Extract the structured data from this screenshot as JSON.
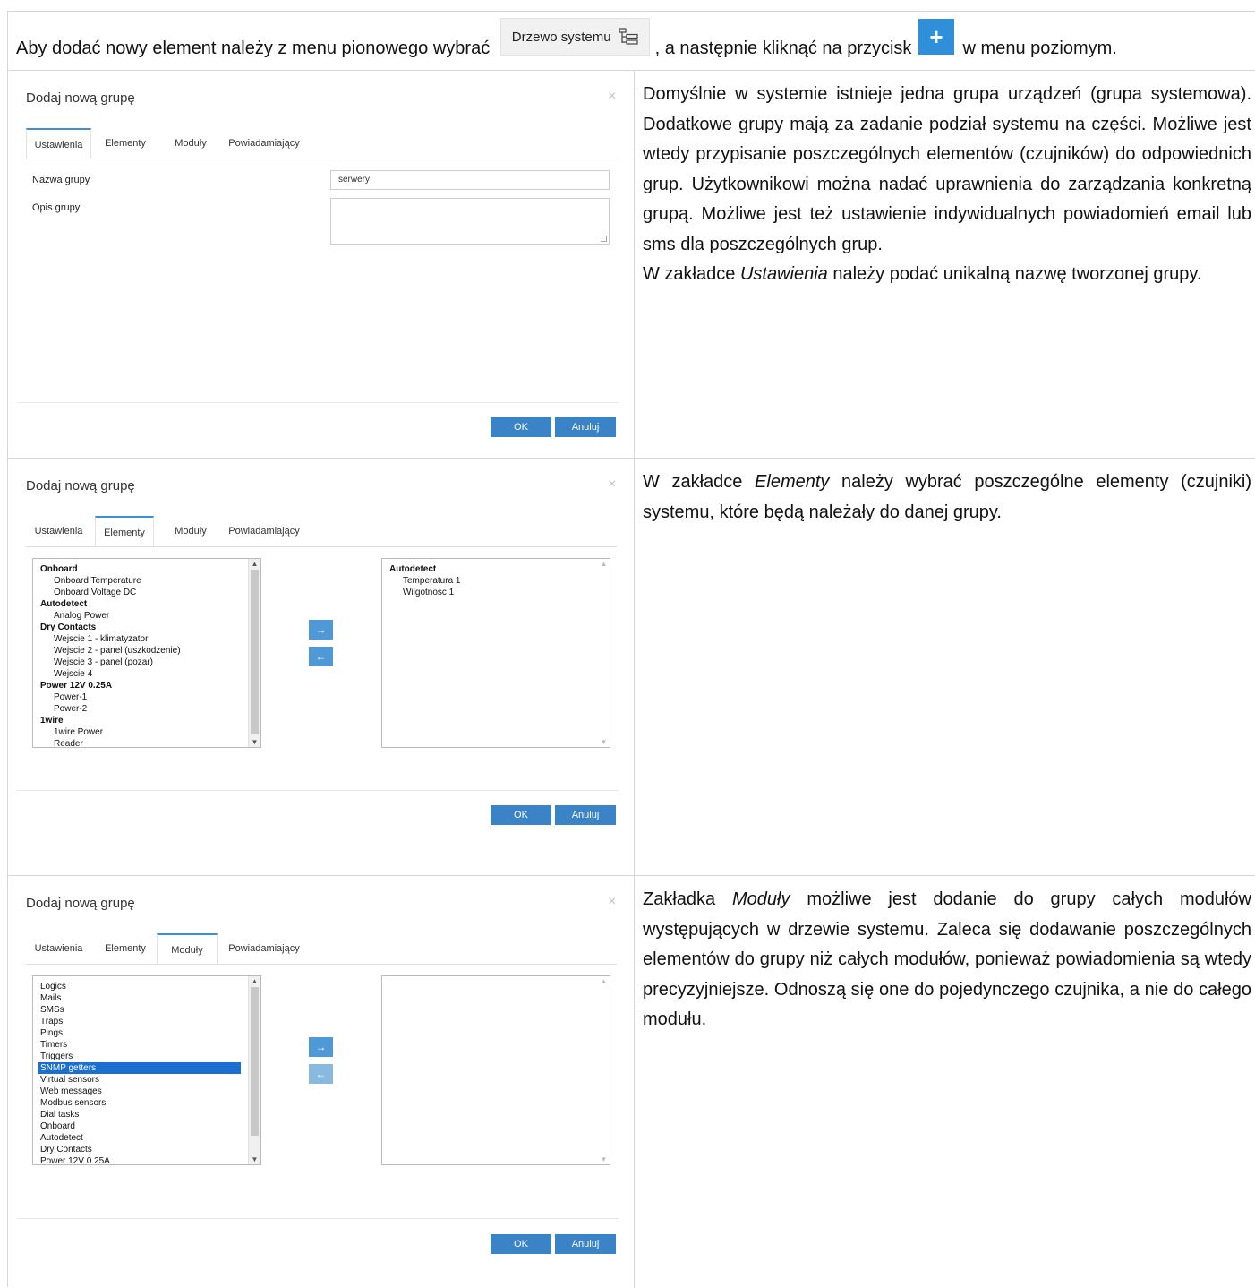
{
  "intro": {
    "text_before": "Aby dodać nowy element należy z menu pionowego wybrać ",
    "tree_button_label": "Drzewo systemu",
    "text_middle": ", a następnie kliknąć na przycisk ",
    "plus_label": "+",
    "text_after": " w menu poziomym."
  },
  "dialog_common": {
    "title": "Dodaj nową grupę",
    "close": "×",
    "tabs": [
      "Ustawienia",
      "Elementy",
      "Moduły",
      "Powiadamiający"
    ],
    "ok": "OK",
    "cancel": "Anuluj",
    "arrow_right": "→",
    "arrow_left": "←"
  },
  "row1": {
    "active_tab": "Ustawienia",
    "name_label": "Nazwa grupy",
    "name_value": "serwery",
    "desc_label": "Opis grupy",
    "description_p1": "Domyślnie w systemie istnieje jedna grupa urządzeń (grupa systemowa). Dodatkowe grupy mają za zadanie podział systemu na części. Możliwe jest wtedy przypisanie poszczególnych elementów (czujników) do odpowiednich grup. Użytkownikowi można nadać uprawnienia do zarządzania konkretną grupą. Możliwe jest też ustawienie indywidualnych powiadomień email lub sms dla poszczególnych grup.",
    "description_p2_before": "W zakładce ",
    "description_p2_em": "Ustawienia",
    "description_p2_after": " należy podać unikalną nazwę tworzonej grupy."
  },
  "row2": {
    "active_tab": "Elementy",
    "left_list": [
      {
        "text": "Onboard",
        "group": true
      },
      {
        "text": "Onboard Temperature",
        "group": false
      },
      {
        "text": "Onboard Voltage DC",
        "group": false
      },
      {
        "text": "Autodetect",
        "group": true
      },
      {
        "text": "Analog Power",
        "group": false
      },
      {
        "text": "Dry Contacts",
        "group": true
      },
      {
        "text": "Wejscie 1 - klimatyzator",
        "group": false
      },
      {
        "text": "Wejscie 2 - panel (uszkodzenie)",
        "group": false
      },
      {
        "text": "Wejscie 3 - panel (pozar)",
        "group": false
      },
      {
        "text": "Wejscie 4",
        "group": false
      },
      {
        "text": "Power 12V 0.25A",
        "group": true
      },
      {
        "text": "Power-1",
        "group": false
      },
      {
        "text": "Power-2",
        "group": false
      },
      {
        "text": "1wire",
        "group": true
      },
      {
        "text": "1wire Power",
        "group": false
      },
      {
        "text": "Reader",
        "group": false
      }
    ],
    "right_list": [
      {
        "text": "Autodetect",
        "group": true
      },
      {
        "text": "Temperatura 1",
        "group": false
      },
      {
        "text": "Wilgotnosc 1",
        "group": false
      }
    ],
    "description_before": "W zakładce ",
    "description_em": "Elementy",
    "description_after": " należy wybrać poszczególne elementy (czujniki) systemu, które będą należały do danej grupy."
  },
  "row3": {
    "active_tab": "Moduły",
    "left_list": [
      "Logics",
      "Mails",
      "SMSs",
      "Traps",
      "Pings",
      "Timers",
      "Triggers",
      "SNMP getters",
      "Virtual sensors",
      "Web messages",
      "Modbus sensors",
      "Dial tasks",
      "Onboard",
      "Autodetect",
      "Dry Contacts",
      "Power 12V 0.25A"
    ],
    "selected": "SNMP getters",
    "description_before": "Zakładka ",
    "description_em": "Moduły",
    "description_after": " możliwe jest dodanie do grupy całych modułów występujących w drzewie systemu. Zaleca się dodawanie poszczególnych elementów do grupy niż całych modułów, ponieważ powiadomienia są wtedy precyzyjniejsze. Odnoszą się one do pojedynczego czujnika, a nie do całego modułu."
  }
}
